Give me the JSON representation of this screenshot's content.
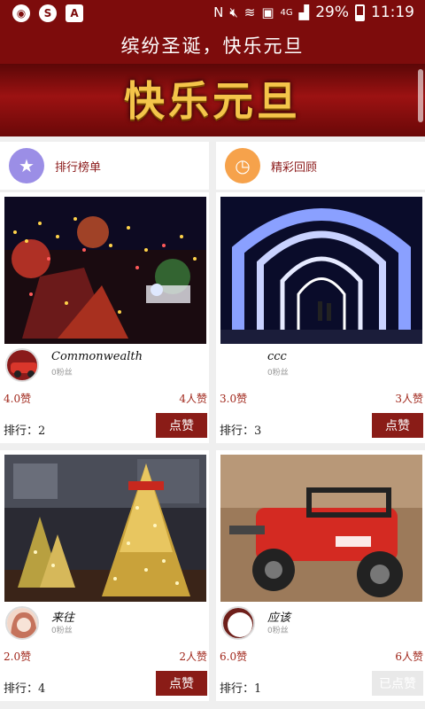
{
  "status": {
    "battery": "29%",
    "time": "11:19",
    "network": "4G"
  },
  "header": {
    "title": "缤纷圣诞，快乐元旦"
  },
  "banner": {
    "text": "快乐元旦"
  },
  "categories": [
    {
      "label": "排行榜单",
      "icon": "medal-icon",
      "color": "#9b8ee6"
    },
    {
      "label": "精彩回顾",
      "icon": "clock-icon",
      "color": "#f6a24b"
    }
  ],
  "cards": [
    {
      "name": "Commonwealth",
      "fans": "0粉丝",
      "score": "4.0赞",
      "votes": "4人赞",
      "rank": "排行：2",
      "button": "点赞"
    },
    {
      "name": "ccc",
      "fans": "0粉丝",
      "score": "3.0赞",
      "votes": "3人赞",
      "rank": "排行：3",
      "button": "点赞"
    },
    {
      "name": "来往",
      "fans": "0粉丝",
      "score": "2.0赞",
      "votes": "2人赞",
      "rank": "排行：4",
      "button": "点赞"
    },
    {
      "name": "应该",
      "fans": "0粉丝",
      "score": "6.0赞",
      "votes": "6人赞",
      "rank": "排行：1",
      "button": "已点赞"
    }
  ],
  "colors": {
    "brand": "#7d0c0c",
    "button": "#8a1c17",
    "accent_text": "#a0261a"
  }
}
